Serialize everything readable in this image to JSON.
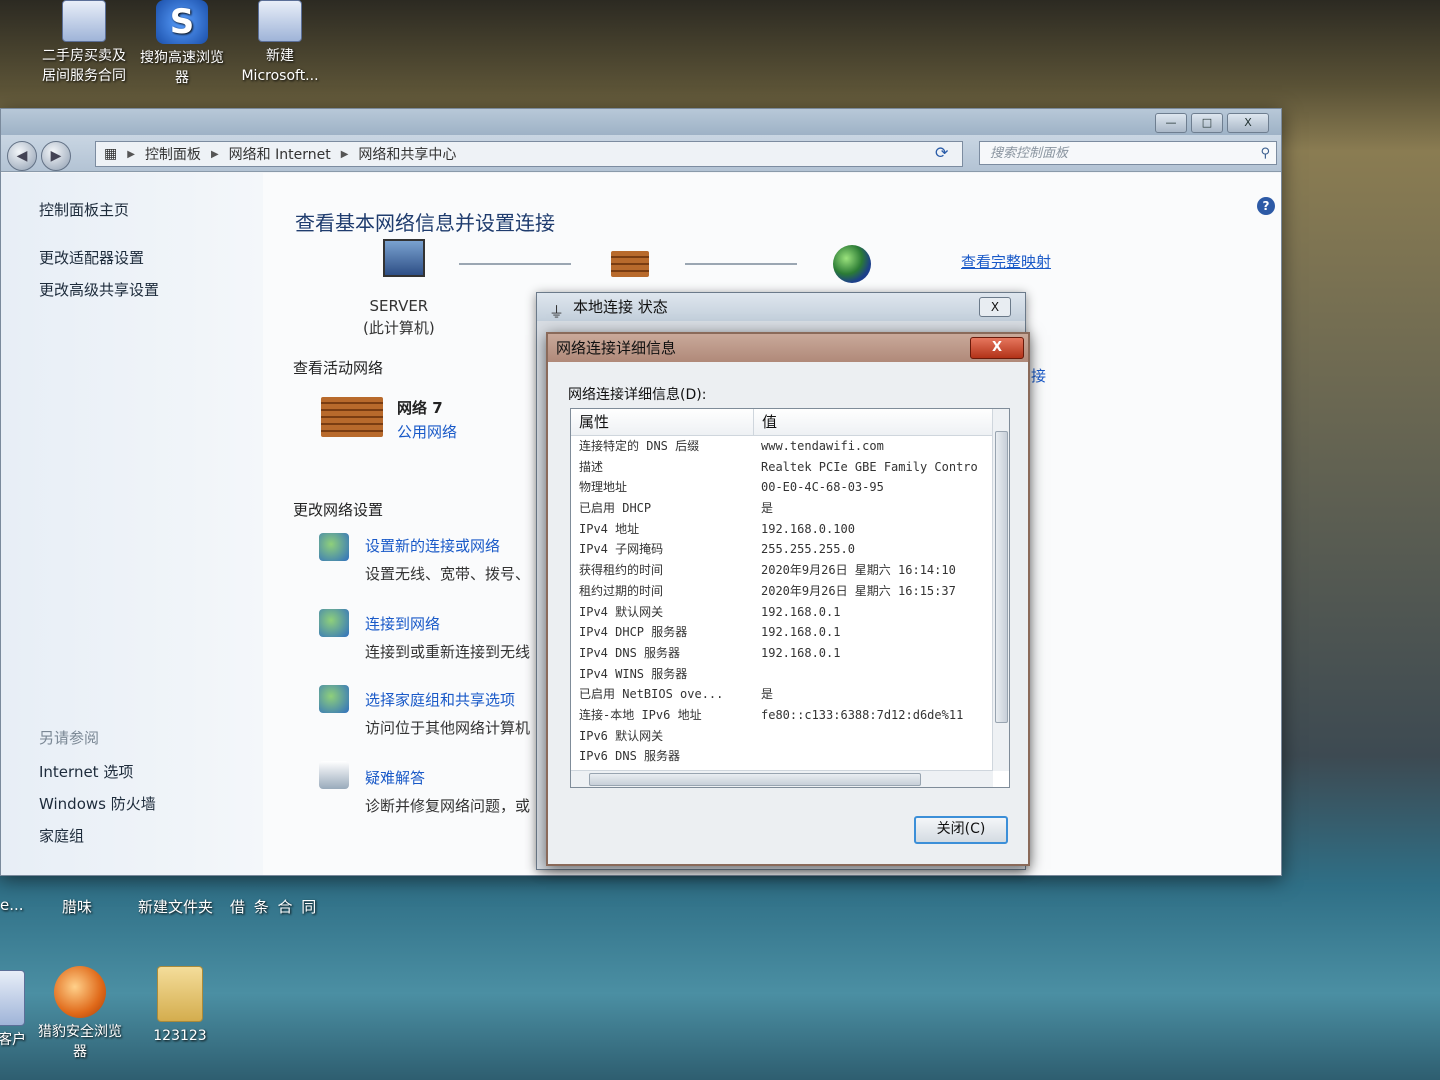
{
  "desktop": {
    "top_icons": [
      {
        "label": "二手房买卖及",
        "label2": "居间服务合同"
      },
      {
        "label": "搜狗高速浏览",
        "label2": "器"
      },
      {
        "label": "新建",
        "label2": "Microsoft..."
      }
    ],
    "row_labels": [
      "e...",
      "腊味",
      "新建文件夹",
      "借 条 合 同"
    ],
    "bottom_icons": [
      {
        "label": "客户"
      },
      {
        "label": "猎豹安全浏览",
        "label2": "器"
      },
      {
        "label": "123123"
      }
    ]
  },
  "window": {
    "breadcrumb": [
      "控制面板",
      "网络和 Internet",
      "网络和共享中心"
    ],
    "search_placeholder": "搜索控制面板",
    "title_buttons": [
      "—",
      "□",
      "X"
    ]
  },
  "sidebar": {
    "home": "控制面板主页",
    "links": [
      "更改适配器设置",
      "更改高级共享设置"
    ],
    "see_also_heading": "另请参阅",
    "see_also": [
      "Internet 选项",
      "Windows 防火墙",
      "家庭组"
    ]
  },
  "main": {
    "title": "查看基本网络信息并设置连接",
    "map_link": "查看完整映射",
    "pc_name": "SERVER",
    "pc_sub": "(此计算机)",
    "active_heading": "查看活动网络",
    "network_name": "网络  7",
    "network_type": "公用网络",
    "partial_link": "接",
    "change_heading": "更改网络设置",
    "tasks": [
      {
        "link": "设置新的连接或网络",
        "desc": "设置无线、宽带、拨号、"
      },
      {
        "link": "连接到网络",
        "desc": "连接到或重新连接到无线"
      },
      {
        "link": "选择家庭组和共享选项",
        "desc": "访问位于其他网络计算机"
      },
      {
        "link": "疑难解答",
        "desc": "诊断并修复网络问题，或"
      }
    ]
  },
  "status_dialog": {
    "title": "本地连接 状态",
    "close": "X"
  },
  "details_dialog": {
    "title": "网络连接详细信息",
    "close": "X",
    "label": "网络连接详细信息(D):",
    "col_property": "属性",
    "col_value": "值",
    "rows": [
      {
        "p": "连接特定的 DNS 后缀",
        "v": "www.tendawifi.com"
      },
      {
        "p": "描述",
        "v": "Realtek PCIe GBE Family Contro"
      },
      {
        "p": "物理地址",
        "v": "00-E0-4C-68-03-95"
      },
      {
        "p": "已启用 DHCP",
        "v": "是"
      },
      {
        "p": "IPv4 地址",
        "v": "192.168.0.100"
      },
      {
        "p": "IPv4 子网掩码",
        "v": "255.255.255.0"
      },
      {
        "p": "获得租约的时间",
        "v": "2020年9月26日 星期六 16:14:10"
      },
      {
        "p": "租约过期的时间",
        "v": "2020年9月26日 星期六 16:15:37"
      },
      {
        "p": "IPv4 默认网关",
        "v": "192.168.0.1"
      },
      {
        "p": "IPv4 DHCP 服务器",
        "v": "192.168.0.1"
      },
      {
        "p": "IPv4 DNS 服务器",
        "v": "192.168.0.1"
      },
      {
        "p": "IPv4 WINS 服务器",
        "v": ""
      },
      {
        "p": "已启用 NetBIOS ove...",
        "v": "是"
      },
      {
        "p": "连接-本地 IPv6 地址",
        "v": "fe80::c133:6388:7d12:d6de%11"
      },
      {
        "p": "IPv6 默认网关",
        "v": ""
      },
      {
        "p": "IPv6 DNS 服务器",
        "v": ""
      }
    ],
    "close_button": "关闭(C)"
  }
}
